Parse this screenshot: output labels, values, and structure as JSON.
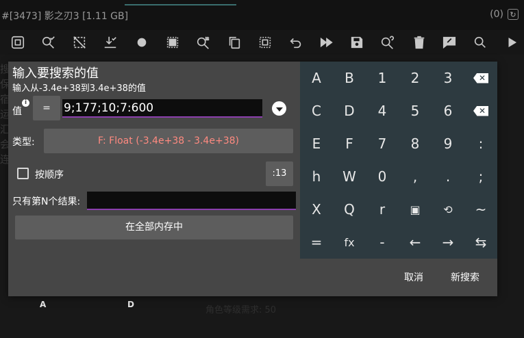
{
  "status_bar": {
    "title": "#[3473] 影之刃3 [1.11 GB]",
    "right_count": "(0)",
    "refresh_icon": "refresh-icon"
  },
  "toolbar": {
    "icons": [
      "select-process-icon",
      "search-checked-icon",
      "select-off-icon",
      "download-check-icon",
      "record-icon",
      "memory-range-icon",
      "search-hash-icon",
      "copy-icon",
      "select-all-icon",
      "undo-icon",
      "fast-forward-icon",
      "save-icon",
      "search-help-icon",
      "delete-icon",
      "edit-note-icon",
      "search-icon",
      "play-icon"
    ]
  },
  "background": {
    "side_text": "搜\n保\n宿\n运\n汇\n会\n连",
    "label_w": "W",
    "label_a": "A",
    "label_d": "D",
    "footer": "角色等级需求: 50"
  },
  "dialog": {
    "title": "输入要搜索的值",
    "subtitle": "输入从-3.4e+38到3.4e+38的值",
    "value_label": "值",
    "operator": "=",
    "value": "9;177;10;7:600",
    "type_label": "类型:",
    "type_value": "F: Float (-3.4e+38 - 3.4e+38)",
    "type_color": "#ff8a80",
    "order_label": "按顺序",
    "order_checked": false,
    "align_value": ":13",
    "nth_label": "只有第N个结果:",
    "nth_value": "",
    "region_label": "在全部内存中",
    "cancel_label": "取消",
    "new_search_label": "新搜索",
    "accent_color": "#8b3fae"
  },
  "keyboard": {
    "rows": [
      [
        "A",
        "B",
        "1",
        "2",
        "3",
        "⌫"
      ],
      [
        "C",
        "D",
        "4",
        "5",
        "6",
        "⌦"
      ],
      [
        "E",
        "F",
        "7",
        "8",
        "9",
        ":"
      ],
      [
        "h",
        "W",
        "0",
        ",",
        ".",
        ";"
      ],
      [
        "X",
        "Q",
        "r",
        "▣",
        "⟲",
        "~"
      ],
      [
        "=",
        "fx",
        "-",
        "←",
        "→",
        "⇆"
      ]
    ],
    "icon_keys": {
      "0.5": "backspace-icon",
      "1.5": "delete-forward-icon",
      "4.3": "memory-range-icon",
      "4.4": "history-icon"
    }
  }
}
